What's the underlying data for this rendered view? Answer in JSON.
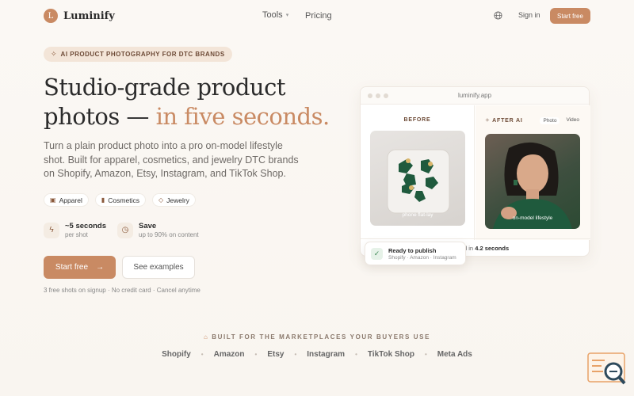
{
  "brand": {
    "logo_letter": "L",
    "name": "Luminify"
  },
  "nav": {
    "tools": "Tools",
    "pricing": "Pricing",
    "sign_in": "Sign in",
    "start_free": "Start free"
  },
  "hero": {
    "badge": "AI PRODUCT PHOTOGRAPHY FOR DTC BRANDS",
    "headline_line1": "Studio-grade product",
    "headline_line2_plain": "photos — ",
    "headline_line2_accent": "in five seconds.",
    "subcopy": "Turn a plain product photo into a pro on-model lifestyle shot. Built for apparel, cosmetics, and jewelry DTC brands on Shopify, Amazon, Etsy, Instagram, and TikTok Shop.",
    "chips": [
      "Apparel",
      "Cosmetics",
      "Jewelry"
    ],
    "stats": [
      {
        "icon": "bolt-icon",
        "main": "~5 seconds",
        "sub": "per shot"
      },
      {
        "icon": "clock-icon",
        "main": "Save",
        "sub": "up to 90% on content"
      }
    ],
    "cta_primary": "Start free",
    "cta_secondary": "See examples",
    "fineprint": "3 free shots on signup · No credit card · Cancel anytime"
  },
  "preview": {
    "url": "luminify.app",
    "before_label": "BEFORE",
    "before_caption": "phone flat-lay",
    "after_label": "AFTER AI",
    "after_tabs": [
      "Photo",
      "Video"
    ],
    "after_caption": "on-model lifestyle",
    "footer_prefix": "d in ",
    "footer_time": "4.2 seconds",
    "toast_title": "Ready to publish",
    "toast_sub": "Shopify · Amazon · Instagram"
  },
  "marketplaces": {
    "title": "BUILT FOR THE MARKETPLACES YOUR BUYERS USE",
    "items": [
      "Shopify",
      "Amazon",
      "Etsy",
      "Instagram",
      "TikTok Shop",
      "Meta Ads"
    ]
  },
  "colors": {
    "accent": "#c98a63",
    "background": "#fbf8f4"
  }
}
